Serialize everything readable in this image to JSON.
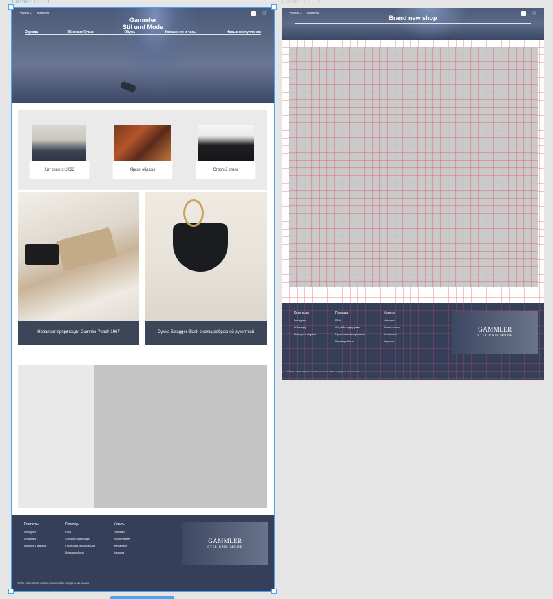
{
  "frames": {
    "frame1": "Desktop - 1",
    "frame2": "Desktop - 2"
  },
  "desktop1": {
    "topbar": {
      "language": "Русский ⌄",
      "contacts": "Контакты"
    },
    "brand_line1": "Gammler",
    "brand_line2": "Stil und Mode",
    "nav": [
      "Одежда",
      "Женские Сумки",
      "Обувь",
      "Украшения и часы",
      "Новые поступления"
    ],
    "cards": [
      "Хит сезона: 2022",
      "Яркие образы",
      "Строгий стиль"
    ],
    "products": [
      {
        "caption": "Новая интерпритация Gamnler Peach 1967"
      },
      {
        "caption": "Сумка Swagger Black с кольцеобразной рукояткой"
      }
    ],
    "footer": {
      "col1": {
        "title": "Контакты",
        "items": [
          "Instagram",
          "Whatsapp",
          "Номера и адреса"
        ]
      },
      "col2": {
        "title": "Помощь",
        "items": [
          "FAQ",
          "Служба поддержки",
          "Правовая информация",
          "Время работы"
        ]
      },
      "col3": {
        "title": "Купить",
        "items": [
          "Новинки",
          "Ассортимент",
          "Желаемое",
          "Корзина"
        ]
      },
      "logo_line1": "GAMMLER",
      "logo_line2": "STIL UND MODE",
      "copyright": "© 2018 – 2022 All rights under the provisions of the copyright Act are reserved"
    }
  },
  "desktop2": {
    "topbar": {
      "language": "Русский ⌄",
      "contacts": "Контакты"
    },
    "brand": "Brand new shop",
    "footer": {
      "col1": {
        "title": "Контакты",
        "items": [
          "Instagram",
          "Whatsapp",
          "Номера и адреса"
        ]
      },
      "col2": {
        "title": "Помощь",
        "items": [
          "FAQ",
          "Служба поддержки",
          "Правовая информация",
          "Время работы"
        ]
      },
      "col3": {
        "title": "Купить",
        "items": [
          "Новинки",
          "Ассортимент",
          "Желаемое",
          "Корзина"
        ]
      },
      "logo_line1": "GAMMLER",
      "logo_line2": "STIL UND MODE",
      "copyright": "© 2018 – 2022 All rights under the provisions of the copyright Act are reserved"
    }
  },
  "colors": {
    "selection": "#4aa3f0",
    "hero": "#4a5a78",
    "footer": "#363f59",
    "grid": "#e65064"
  }
}
